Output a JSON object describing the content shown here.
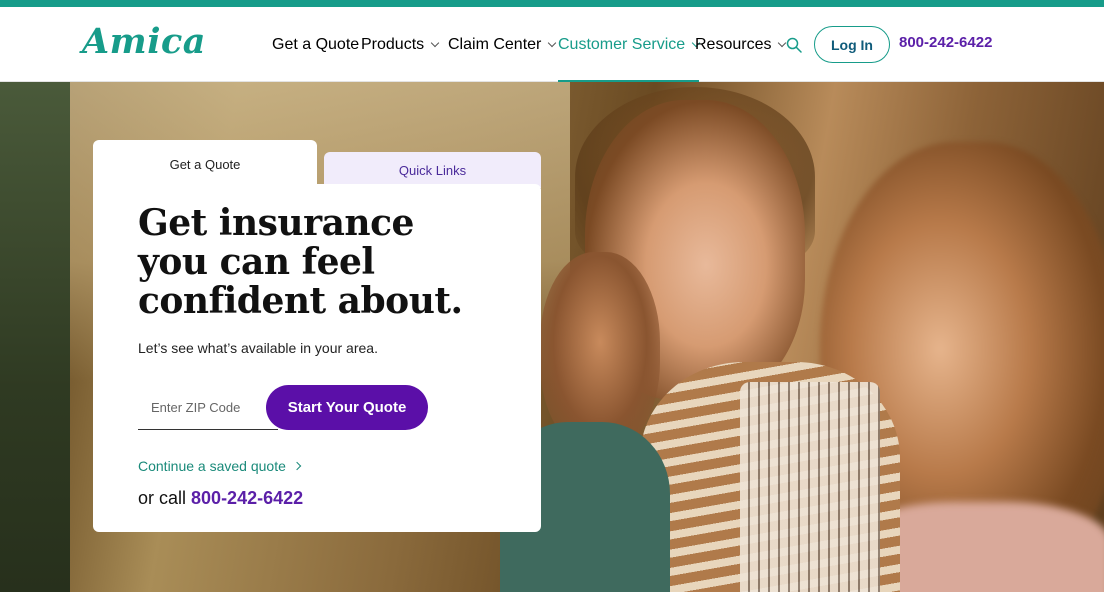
{
  "brand": {
    "logo_text": "Amica",
    "accent_color": "#179c8a",
    "purple": "#5b0fa8"
  },
  "nav": {
    "items": [
      {
        "label": "Get a Quote",
        "has_dropdown": false
      },
      {
        "label": "Products",
        "has_dropdown": true
      },
      {
        "label": "Claim Center",
        "has_dropdown": true
      },
      {
        "label": "Customer Service",
        "has_dropdown": true,
        "active": true
      },
      {
        "label": "Resources",
        "has_dropdown": true
      }
    ],
    "search_icon": "search-icon",
    "login_label": "Log In",
    "phone": "800-242-6422"
  },
  "hero": {
    "tabs": [
      {
        "label": "Get a Quote",
        "active": true
      },
      {
        "label": "Quick Links",
        "active": false
      }
    ],
    "title": "Get insurance you can feel confident about.",
    "subtitle": "Let’s see what’s available in your area.",
    "zip_placeholder": "Enter ZIP Code",
    "zip_value": "",
    "start_button": "Start Your Quote",
    "continue_link": "Continue a saved quote",
    "call_prefix": "or call",
    "call_phone": "800-242-6422"
  }
}
